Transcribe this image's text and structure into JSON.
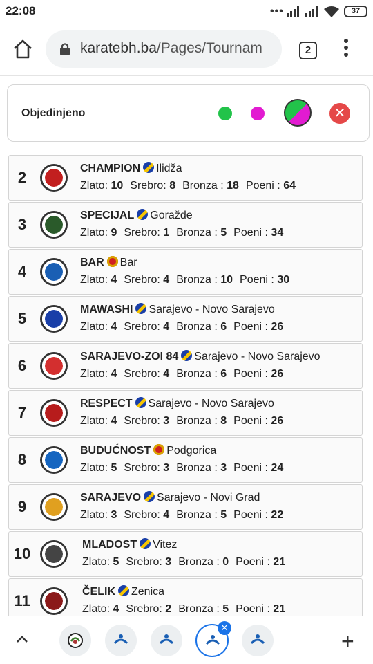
{
  "status_bar": {
    "time": "22:08",
    "battery": "37"
  },
  "browser": {
    "url_domain": "karatebh.ba",
    "url_path": "/Pages/Tournam",
    "tab_count": "2"
  },
  "filter": {
    "label": "Objedinjeno"
  },
  "colors": {
    "green": "#22c34a",
    "pink": "#e21bd1",
    "close": "#e54848",
    "accent": "#1a73e8"
  },
  "labels": {
    "gold": "Zlato:",
    "silver": "Srebro:",
    "bronze": "Bronza :",
    "points": "Poeni :"
  },
  "rows": [
    {
      "rank": "2",
      "club": "CHAMPION",
      "flag": "ba",
      "city": "Ilidža",
      "gold": "10",
      "silver": "8",
      "bronze": "18",
      "points": "64"
    },
    {
      "rank": "3",
      "club": "SPECIJAL",
      "flag": "ba",
      "city": "Goražde",
      "gold": "9",
      "silver": "1",
      "bronze": "5",
      "points": "34"
    },
    {
      "rank": "4",
      "club": "BAR",
      "flag": "me",
      "city": "Bar",
      "gold": "4",
      "silver": "4",
      "bronze": "10",
      "points": "30"
    },
    {
      "rank": "5",
      "club": "MAWASHI",
      "flag": "ba",
      "city": "Sarajevo - Novo Sarajevo",
      "gold": "4",
      "silver": "4",
      "bronze": "6",
      "points": "26"
    },
    {
      "rank": "6",
      "club": "SARAJEVO-ZOI 84",
      "flag": "ba",
      "city": "Sarajevo - Novo Sarajevo",
      "gold": "4",
      "silver": "4",
      "bronze": "6",
      "points": "26"
    },
    {
      "rank": "7",
      "club": "RESPECT",
      "flag": "ba",
      "city": "Sarajevo - Novo Sarajevo",
      "gold": "4",
      "silver": "3",
      "bronze": "8",
      "points": "26"
    },
    {
      "rank": "8",
      "club": "BUDUĆNOST",
      "flag": "me",
      "city": "Podgorica",
      "gold": "5",
      "silver": "3",
      "bronze": "3",
      "points": "24"
    },
    {
      "rank": "9",
      "club": "SARAJEVO",
      "flag": "ba",
      "city": "Sarajevo - Novi Grad",
      "gold": "3",
      "silver": "4",
      "bronze": "5",
      "points": "22"
    },
    {
      "rank": "10",
      "club": "MLADOST",
      "flag": "ba",
      "city": "Vitez",
      "gold": "5",
      "silver": "3",
      "bronze": "0",
      "points": "21"
    },
    {
      "rank": "11",
      "club": "ČELIK",
      "flag": "ba",
      "city": "Zenica",
      "gold": "4",
      "silver": "2",
      "bronze": "5",
      "points": "21"
    }
  ]
}
